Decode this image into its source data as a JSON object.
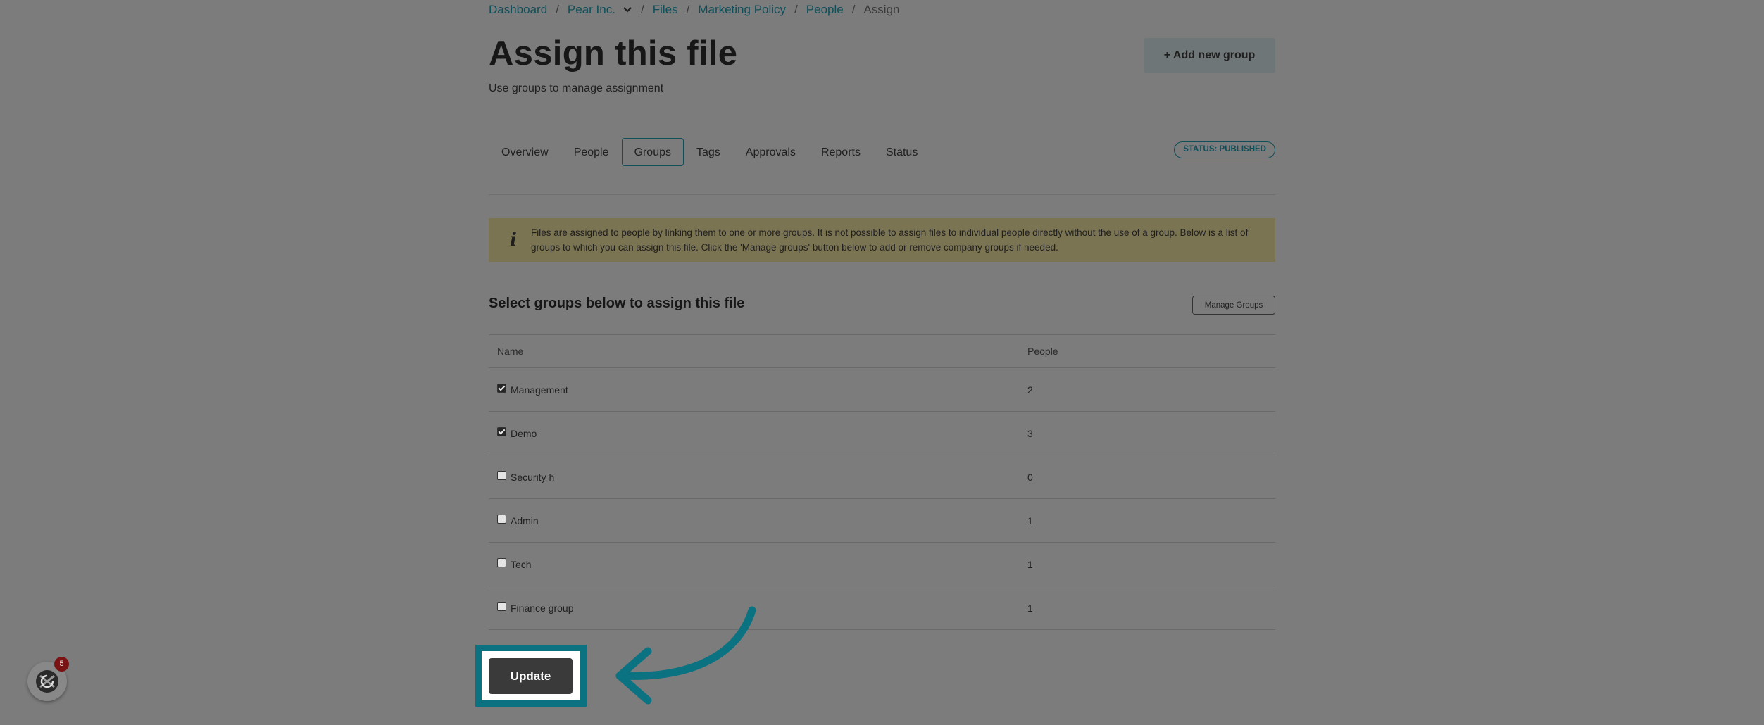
{
  "breadcrumb": {
    "items": [
      "Dashboard",
      "Pear Inc.",
      "Files",
      "Marketing Policy",
      "People"
    ],
    "current": "Assign",
    "separator": "/"
  },
  "header": {
    "title": "Assign this file",
    "subtitle": "Use groups to manage assignment",
    "add_group_label": "+ Add new group"
  },
  "tabs": [
    {
      "label": "Overview",
      "active": false
    },
    {
      "label": "People",
      "active": false
    },
    {
      "label": "Groups",
      "active": true
    },
    {
      "label": "Tags",
      "active": false
    },
    {
      "label": "Approvals",
      "active": false
    },
    {
      "label": "Reports",
      "active": false
    },
    {
      "label": "Status",
      "active": false
    }
  ],
  "status_badge": "STATUS: PUBLISHED",
  "info": {
    "icon": "info-icon",
    "text": "Files are assigned to people by linking them to one or more groups. It is not possible to assign files to individual people directly without the use of a group. Below is a list of groups to which you can assign this file. Click the 'Manage groups' button below to add or remove company groups if needed."
  },
  "groups": {
    "title": "Select groups below to assign this file",
    "manage_label": "Manage Groups",
    "columns": [
      "Name",
      "People"
    ],
    "rows": [
      {
        "name": "Management",
        "people": "2",
        "checked": true
      },
      {
        "name": "Demo",
        "people": "3",
        "checked": true
      },
      {
        "name": "Security h",
        "people": "0",
        "checked": false
      },
      {
        "name": "Admin",
        "people": "1",
        "checked": false
      },
      {
        "name": "Tech",
        "people": "1",
        "checked": false
      },
      {
        "name": "Finance group",
        "people": "1",
        "checked": false
      }
    ]
  },
  "update_label": "Update",
  "notification_count": "5",
  "colors": {
    "accent": "#0f4f5a",
    "highlight": "#0a7280",
    "overlay": "#7c7c7c"
  }
}
